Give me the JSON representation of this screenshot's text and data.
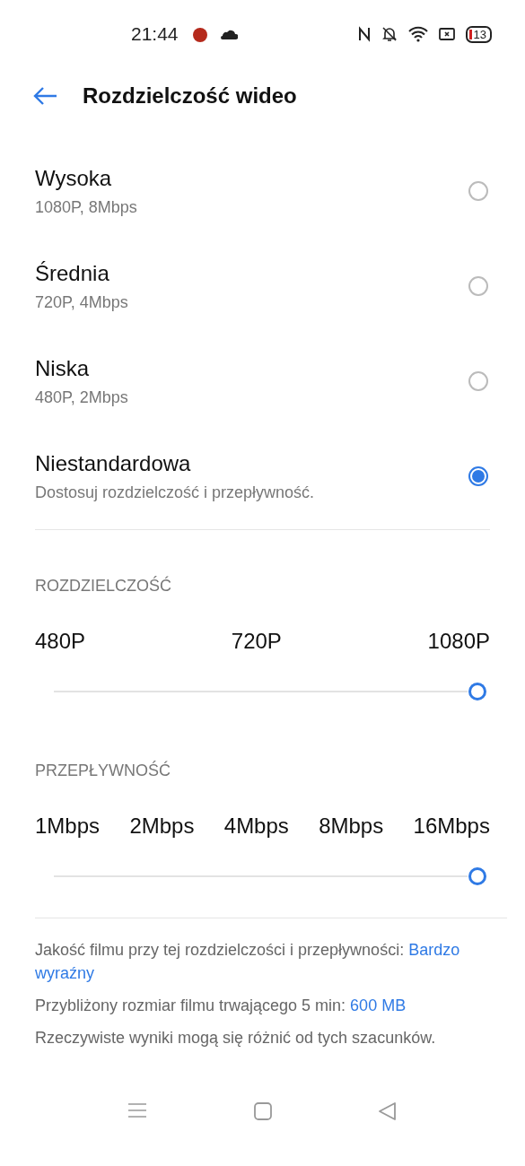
{
  "status_bar": {
    "time": "21:44",
    "battery": "13"
  },
  "header": {
    "title": "Rozdzielczość wideo"
  },
  "options": [
    {
      "title": "Wysoka",
      "subtitle": "1080P, 8Mbps",
      "selected": false
    },
    {
      "title": "Średnia",
      "subtitle": "720P, 4Mbps",
      "selected": false
    },
    {
      "title": "Niska",
      "subtitle": "480P, 2Mbps",
      "selected": false
    },
    {
      "title": "Niestandardowa",
      "subtitle": "Dostosuj rozdzielczość i przepływność.",
      "selected": true
    }
  ],
  "sliders": [
    {
      "label": "ROZDZIELCZOŚĆ",
      "ticks": [
        "480P",
        "720P",
        "1080P"
      ],
      "level": 1
    },
    {
      "label": "PRZEPŁYWNOŚĆ",
      "ticks": [
        "1Mbps",
        "2Mbps",
        "4Mbps",
        "8Mbps",
        "16Mbps"
      ],
      "level": 1
    }
  ],
  "info": [
    {
      "text": "Jakość filmu przy tej rozdzielczości i przepływności: ",
      "value": "Bardzo wyraźny"
    },
    {
      "text": "Przybliżony rozmiar filmu trwającego 5 min: ",
      "value": "600 MB"
    },
    {
      "text": "Rzeczywiste wyniki mogą się różnić od tych szacunków."
    }
  ]
}
